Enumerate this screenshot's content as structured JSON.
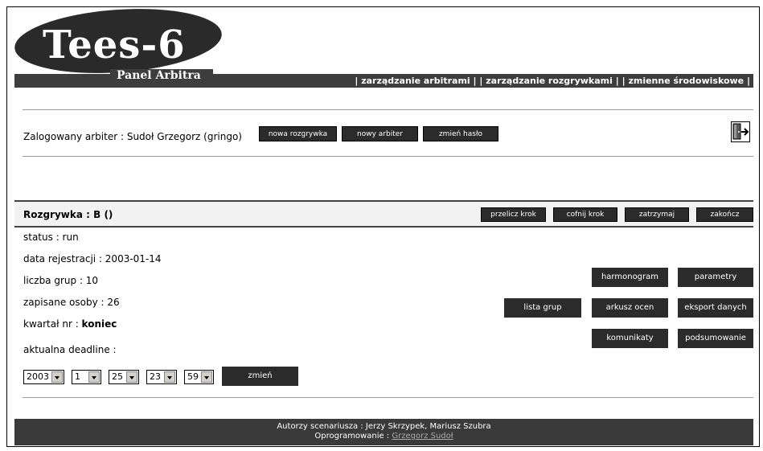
{
  "logo": {
    "title": "Tees-6",
    "subtitle": "Panel Arbitra"
  },
  "topnav": {
    "item1": "| zarządzanie arbitrami |",
    "item2": "| zarządzanie rozgrywkami |",
    "item3": "| zmienne środowiskowe |"
  },
  "user": {
    "logged": "Zalogowany arbiter : Sudoł Grzegorz (gringo)",
    "buttons": [
      "nowa rozgrywka",
      "nowy arbiter",
      "zmień hasło"
    ]
  },
  "game": {
    "title": "Rozgrywka : B ()",
    "buttons": [
      "przelicz krok",
      "cofnij krok",
      "zatrzymaj",
      "zakończ"
    ]
  },
  "details": {
    "status": "status : run",
    "registered": "data rejestracji : 2003-01-14",
    "groups": "liczba grup : 10",
    "people": "zapisane osoby : 26",
    "quarter_label": "kwartał nr : ",
    "quarter_value": "koniec",
    "deadline": "aktualna deadline :"
  },
  "deadline_selects": [
    "2003",
    "1",
    "25",
    "23",
    "59"
  ],
  "change_button": "zmień",
  "actions": {
    "harmonogram": "harmonogram",
    "parametry": "parametry",
    "lista_grup": "lista grup",
    "arkusz_ocen": "arkusz ocen",
    "eksport": "eksport danych",
    "komunikaty": "komunikaty",
    "podsumowanie": "podsumowanie"
  },
  "footer": {
    "authors": "Autorzy scenariusza : Jerzy Skrzypek, Mariusz Szubra",
    "programming_label": "Oprogramowanie : ",
    "programming_name": "Grzegorz Sudoł"
  },
  "icons": {
    "logout": "logout-door-icon"
  }
}
